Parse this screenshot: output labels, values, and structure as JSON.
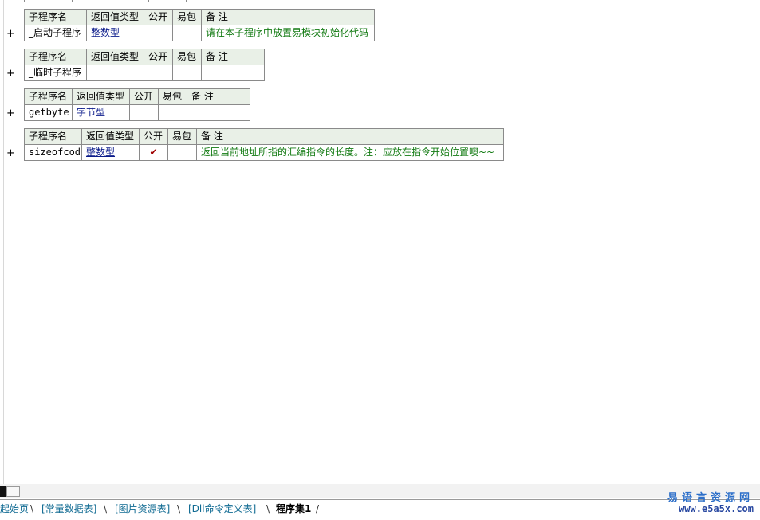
{
  "header_labels": {
    "name": "子程序名",
    "return_type": "返回值类型",
    "public": "公开",
    "pack": "易包",
    "note": "备 注"
  },
  "subroutines": [
    {
      "name": "_启动子程序",
      "return_type": "整数型",
      "public": "",
      "pack": "",
      "note": "请在本子程序中放置易模块初始化代码"
    },
    {
      "name": "_临时子程序",
      "return_type": "",
      "public": "",
      "pack": "",
      "note": ""
    },
    {
      "name": "getbyte",
      "return_type": "字节型",
      "public": "",
      "pack": "",
      "note": ""
    },
    {
      "name": "sizeofcode",
      "return_type": "整数型",
      "public": "✔",
      "pack": "",
      "note": "返回当前地址所指的汇编指令的长度。注：应放在指令开始位置噢~~"
    }
  ],
  "expand_symbol": "+",
  "tabs": [
    {
      "label": "起始页",
      "active": false
    },
    {
      "label": "[常量数据表]",
      "active": false
    },
    {
      "label": "[图片资源表]",
      "active": false
    },
    {
      "label": "[Dll命令定义表]",
      "active": false
    },
    {
      "label": "程序集1",
      "active": true
    }
  ],
  "watermark": {
    "title": "易语言资源网",
    "url": "www.e5a5x.com"
  },
  "colors": {
    "header_bg": "#e9f0e7",
    "type_text": "#0a1a8a",
    "note_text": "#127a12",
    "tab_text": "#0f6a92",
    "watermark": "#2c6fc9"
  }
}
